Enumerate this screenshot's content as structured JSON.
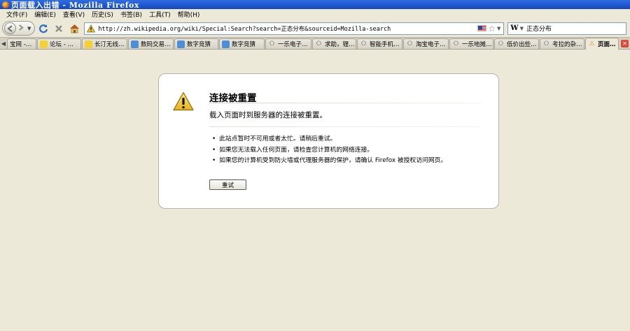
{
  "window": {
    "title": "页面载入出错 - Mozilla Firefox"
  },
  "menubar": {
    "items": [
      "文件(F)",
      "编辑(E)",
      "查看(V)",
      "历史(S)",
      "书签(B)",
      "工具(T)",
      "帮助(H)"
    ]
  },
  "navbar": {
    "back_icon": "back-arrow-icon",
    "forward_icon": "forward-arrow-icon",
    "url": "http://zh.wikipedia.org/wiki/Special:Search?search=正态分布&sourceid=Mozilla-search",
    "search_value": "正态分布",
    "search_engine_letter": "W"
  },
  "tabs": [
    {
      "label": "宝网 -…",
      "icon": "none"
    },
    {
      "label": "论坛 - …",
      "icon": "yellow"
    },
    {
      "label": "长汀无线…",
      "icon": "yellow"
    },
    {
      "label": "数码交易…",
      "icon": "blue"
    },
    {
      "label": "数字竞猜",
      "icon": "blue"
    },
    {
      "label": "数字竞猜",
      "icon": "blue"
    },
    {
      "label": "一乐电子…",
      "icon": "wifi"
    },
    {
      "label": "求助，锂…",
      "icon": "wifi"
    },
    {
      "label": "智能手机…",
      "icon": "wifi"
    },
    {
      "label": "淘宝电子…",
      "icon": "wifi"
    },
    {
      "label": "一乐地摊…",
      "icon": "wifi"
    },
    {
      "label": "低价出些…",
      "icon": "wifi"
    },
    {
      "label": "考拉的杂…",
      "icon": "wifi"
    },
    {
      "label": "页面…",
      "icon": "warning",
      "active": true
    }
  ],
  "error": {
    "title": "连接被重置",
    "description": "载入页面时到服务器的连接被重置。",
    "bullets": [
      "此站点暂时不可用或者太忙。请稍后重试。",
      "如果您无法载入任何页面，请检查您计算机的网络连接。",
      "如果您的计算机受到防火墙或代理服务器的保护，请确认 Firefox 被授权访问网页。"
    ],
    "retry_label": "重试"
  },
  "colors": {
    "chrome": "#ECE9D8",
    "titlebar": "#1F56D0",
    "close_tab": "#D94A3A"
  }
}
